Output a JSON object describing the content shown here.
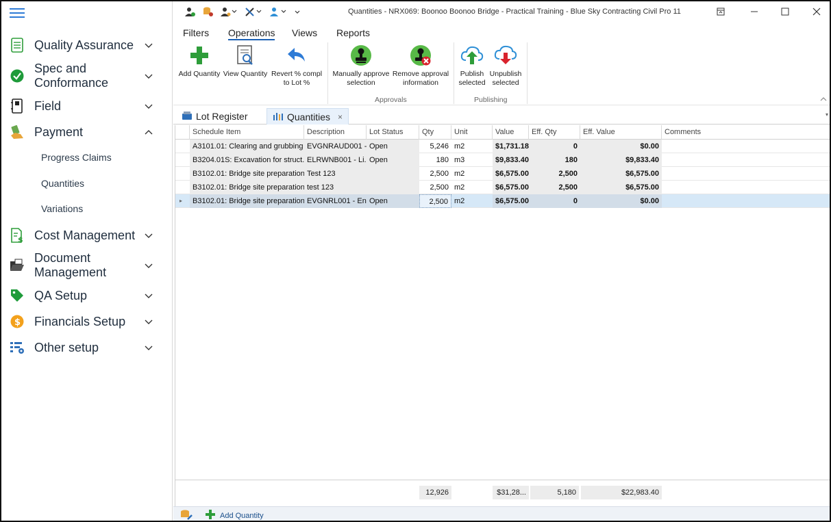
{
  "window": {
    "title": "Quantities - NRX069: Boonoo Boonoo Bridge - Practical Training - Blue Sky Contracting Civil Pro 11"
  },
  "sidebar": {
    "items": [
      {
        "label": "Quality Assurance",
        "icon": "checklist-icon",
        "expanded": false
      },
      {
        "label": "Spec and Conformance",
        "icon": "check-circle-icon",
        "expanded": false
      },
      {
        "label": "Field",
        "icon": "field-book-icon",
        "expanded": false
      },
      {
        "label": "Payment",
        "icon": "payment-hand-icon",
        "expanded": true
      },
      {
        "label": "Cost Management",
        "icon": "cost-sheet-icon",
        "expanded": false
      },
      {
        "label": "Document Management",
        "icon": "folder-open-icon",
        "expanded": false
      },
      {
        "label": "QA Setup",
        "icon": "tag-icon",
        "expanded": false
      },
      {
        "label": "Financials Setup",
        "icon": "dollar-coin-icon",
        "expanded": false
      },
      {
        "label": "Other setup",
        "icon": "settings-list-icon",
        "expanded": false
      }
    ],
    "payment_subitems": [
      "Progress Claims",
      "Quantities",
      "Variations"
    ],
    "spec_line1": "Spec and",
    "spec_line2": "Conformance",
    "doc_line1": "Document",
    "doc_line2": "Management"
  },
  "ribbon": {
    "tabs": [
      "Filters",
      "Operations",
      "Views",
      "Reports"
    ],
    "active_tab": "Operations",
    "buttons": {
      "add_quantity": "Add Quantity",
      "view_quantity": "View Quantity",
      "revert_line1": "Revert % compl",
      "revert_line2": "to Lot %",
      "manually_line1": "Manually approve",
      "manually_line2": "selection",
      "remove_line1": "Remove approval",
      "remove_line2": "information",
      "publish_line1": "Publish",
      "publish_line2": "selected",
      "unpublish_line1": "Unpublish",
      "unpublish_line2": "selected"
    },
    "groups": {
      "approvals": "Approvals",
      "publishing": "Publishing"
    }
  },
  "doc_tabs": {
    "lot_register": "Lot Register",
    "quantities": "Quantities",
    "close": "×"
  },
  "grid": {
    "columns": [
      "Schedule Item",
      "Description",
      "Lot Status",
      "Qty",
      "Unit",
      "Value",
      "Eff. Qty",
      "Eff. Value",
      "Comments"
    ],
    "rows": [
      {
        "schedule": "A3101.01: Clearing and grubbing",
        "description": "EVGNRAUD001 -...",
        "status": "Open",
        "qty": "5,246",
        "unit": "m2",
        "value": "$1,731.18",
        "eff_qty": "0",
        "eff_value": "$0.00",
        "comments": ""
      },
      {
        "schedule": "B3204.01S: Excavation for struct...",
        "description": "ELRWNB001 - Li...",
        "status": "Open",
        "qty": "180",
        "unit": "m3",
        "value": "$9,833.40",
        "eff_qty": "180",
        "eff_value": "$9,833.40",
        "comments": ""
      },
      {
        "schedule": "B3102.01: Bridge site preparation",
        "description": "Test 123",
        "status": "",
        "qty": "2,500",
        "unit": "m2",
        "value": "$6,575.00",
        "eff_qty": "2,500",
        "eff_value": "$6,575.00",
        "comments": ""
      },
      {
        "schedule": "B3102.01: Bridge site preparation",
        "description": "test 123",
        "status": "",
        "qty": "2,500",
        "unit": "m2",
        "value": "$6,575.00",
        "eff_qty": "2,500",
        "eff_value": "$6,575.00",
        "comments": ""
      },
      {
        "schedule": "B3102.01: Bridge site preparation",
        "description": "EVGNRL001 - En...",
        "status": "Open",
        "qty": "2,500",
        "unit": "m2",
        "value": "$6,575.00",
        "eff_qty": "0",
        "eff_value": "$0.00",
        "comments": ""
      }
    ],
    "selected_row": 4,
    "totals": {
      "qty": "12,926",
      "value": "$31,28...",
      "eff_qty": "5,180",
      "eff_value": "$22,983.40"
    }
  },
  "statusbar": {
    "add_quantity": "Add Quantity"
  },
  "colors": {
    "accent": "#1a5fb4",
    "green": "#2e9d3a",
    "selected_row": "#d6e8f7"
  }
}
